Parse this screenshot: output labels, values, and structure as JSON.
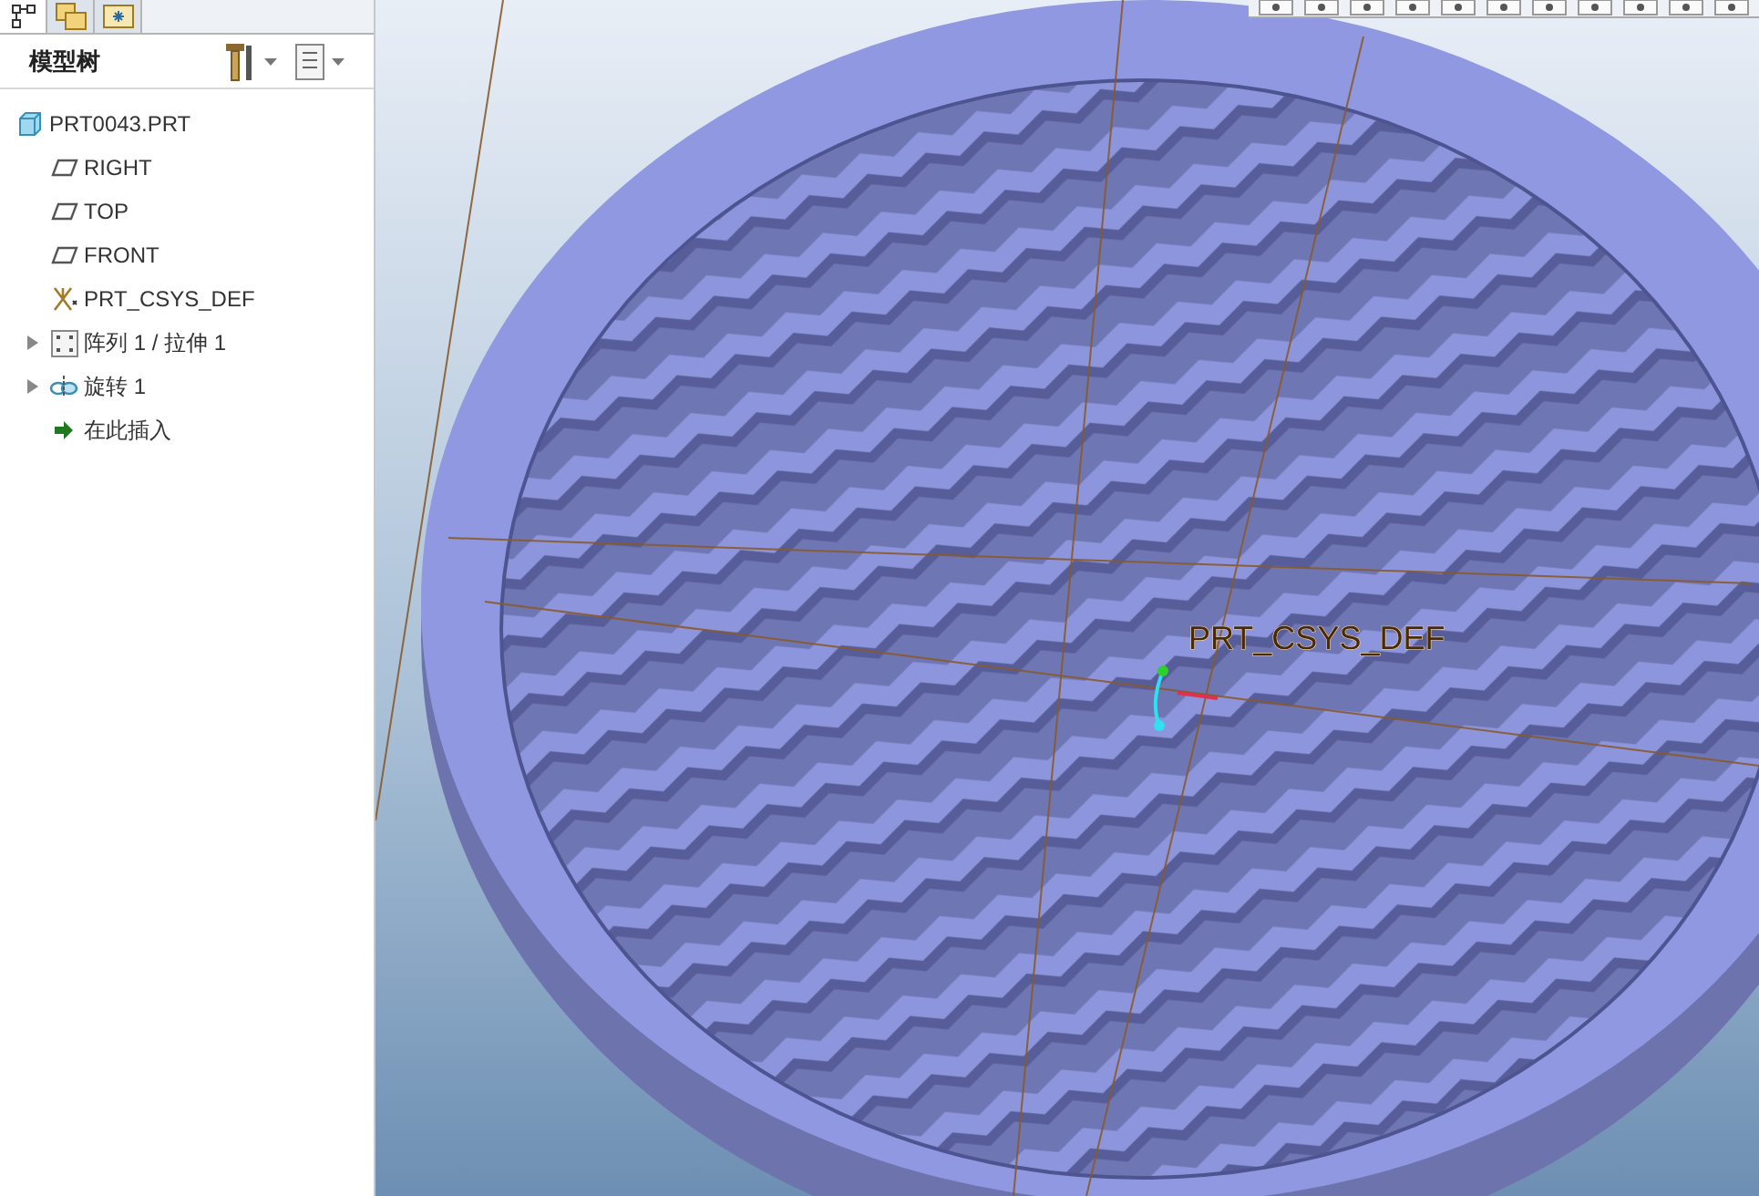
{
  "panel_tabs": [
    {
      "selected": true
    },
    {
      "selected": false
    },
    {
      "selected": false
    }
  ],
  "model_tree": {
    "title": "模型树",
    "items": [
      {
        "kind": "part",
        "label": "PRT0043.PRT"
      },
      {
        "kind": "plane",
        "label": "RIGHT"
      },
      {
        "kind": "plane",
        "label": "TOP"
      },
      {
        "kind": "plane",
        "label": "FRONT"
      },
      {
        "kind": "csys",
        "label": "PRT_CSYS_DEF"
      },
      {
        "kind": "pattern",
        "label": "阵列 1 / 拉伸 1",
        "expanded": false
      },
      {
        "kind": "revolve",
        "label": "旋转 1",
        "expanded": false
      },
      {
        "kind": "insert",
        "label": "在此插入"
      }
    ]
  },
  "viewport": {
    "csys_label": "PRT_CSYS_DEF"
  }
}
